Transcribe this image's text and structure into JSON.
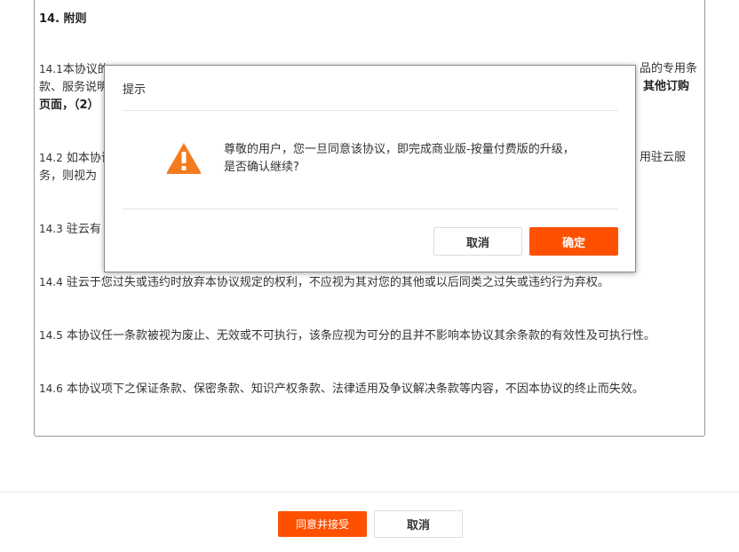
{
  "document": {
    "section_title": "14. 附则",
    "clauses": [
      {
        "num": "14.1",
        "text_a": "本协议的",
        "text_b": "品的专用条",
        "line2_a": "款、服务说明",
        "line2_b": "其他订购",
        "line3_a": "页面，（2）"
      },
      {
        "num": "14.2",
        "text_a": "如本协议",
        "text_b": "用驻云服",
        "line2_a": "务，则视为"
      },
      {
        "num": "14.3",
        "text_a": "驻云有"
      },
      {
        "num": "14.4",
        "text": "驻云于您过失或违约时放弃本协议规定的权利，不应视为其对您的其他或以后同类之过失或违约行为弃权。"
      },
      {
        "num": "14.5",
        "text": "本协议任一条款被视为废止、无效或不可执行，该条应视为可分的且并不影响本协议其余条款的有效性及可执行性。"
      },
      {
        "num": "14.6",
        "text": "本协议项下之保证条款、保密条款、知识产权条款、法律适用及争议解决条款等内容，不因本协议的终止而失效。"
      }
    ]
  },
  "footer": {
    "agree_label": "同意并接受",
    "cancel_label": "取消"
  },
  "modal": {
    "title": "提示",
    "message": "尊敬的用户，您一旦同意该协议，即完成商业版-按量付费版的升级，是否确认继续?",
    "icon": "warning-icon",
    "cancel_label": "取消",
    "confirm_label": "确定"
  },
  "colors": {
    "accent": "#ff5000",
    "warning": "#f47b20"
  }
}
